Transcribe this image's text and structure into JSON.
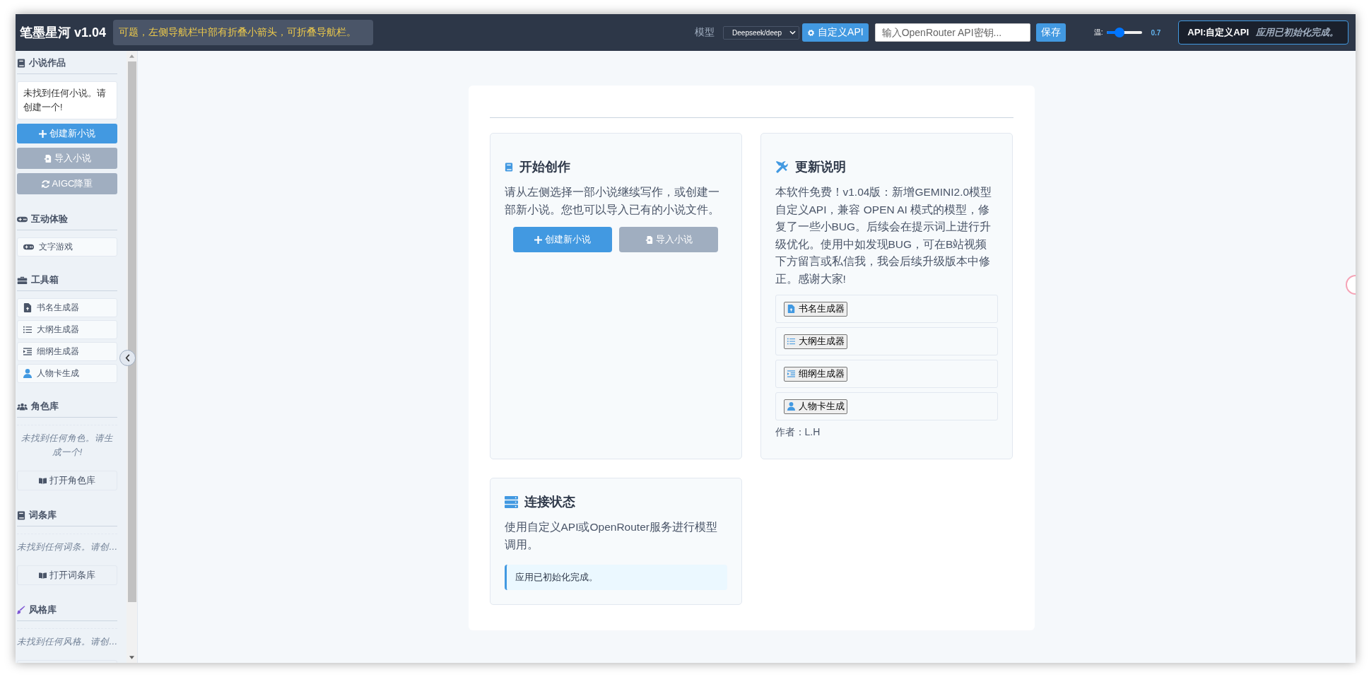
{
  "header": {
    "title": "笔墨星河 v1.04",
    "notice": "可题，左侧导航栏中部有折叠小箭头，可折叠导航栏。",
    "model_label": "模型",
    "model_value": "Deepseek/deep",
    "custom_api_button": "自定义API",
    "api_key": {
      "placeholder": "输入OpenRouter API密钥..."
    },
    "save_button": "保存",
    "temperature": {
      "label": "温:",
      "level": 0.35,
      "reading": "0.7"
    },
    "status": {
      "api": "API:自定义API",
      "message": "应用已初始化完成。"
    }
  },
  "sidebar": {
    "sections": [
      {
        "title": "小说作品",
        "empty": {
          "kind": "box",
          "text": "未找到任何小说。请创建一个!"
        },
        "buttons": [
          {
            "label": "创建新小说",
            "kind": "primary"
          },
          {
            "label": "导入小说",
            "kind": "secondary"
          },
          {
            "label": "AIGC降重",
            "kind": "secondary"
          }
        ]
      },
      {
        "title": "互动体验",
        "items": [
          "文字游戏"
        ]
      },
      {
        "title": "工具箱",
        "items": [
          "书名生成器",
          "大纲生成器",
          "细纲生成器",
          "人物卡生成"
        ]
      },
      {
        "title": "角色库",
        "empty": {
          "kind": "italic",
          "text": "未找到任何角色。请生成一个!"
        },
        "buttons": [
          {
            "label": "打开角色库",
            "kind": "outline"
          }
        ]
      },
      {
        "title": "词条库",
        "empty": {
          "kind": "italic",
          "text": "未找到任何词条。请创…"
        },
        "buttons": [
          {
            "label": "打开词条库",
            "kind": "outline"
          }
        ]
      },
      {
        "title": "风格库",
        "empty": {
          "kind": "italic",
          "text": "未找到任何风格。请创…"
        },
        "buttons": [
          {
            "kind": "outline"
          }
        ]
      }
    ]
  },
  "cards": [
    {
      "title": "开始创作",
      "text": "请从左侧选择一部小说继续写作，或创建一部新小说。您也可以导入已有的小说文件。",
      "buttons": [
        {
          "label": "创建新小说",
          "kind": "primary"
        },
        {
          "label": "导入小说",
          "kind": "secondary"
        }
      ]
    },
    {
      "title": "更新说明",
      "text": "本软件免费！v1.04版：新增GEMINI2.0模型自定义API，兼容 OPEN AI 模式的模型，修复了一些小BUG。后续会在提示词上进行升级优化。使用中如发现BUG，可在B站视频下方留言或私信我，我会后续升级版本中修正。感谢大家!",
      "tools": [
        "书名生成器",
        "大纲生成器",
        "细纲生成器",
        "人物卡生成"
      ],
      "author": "作者：L.H"
    },
    {
      "title": "连接状态",
      "text": "使用自定义API或OpenRouter服务进行模型调用。",
      "status": "应用已初始化完成。"
    }
  ]
}
